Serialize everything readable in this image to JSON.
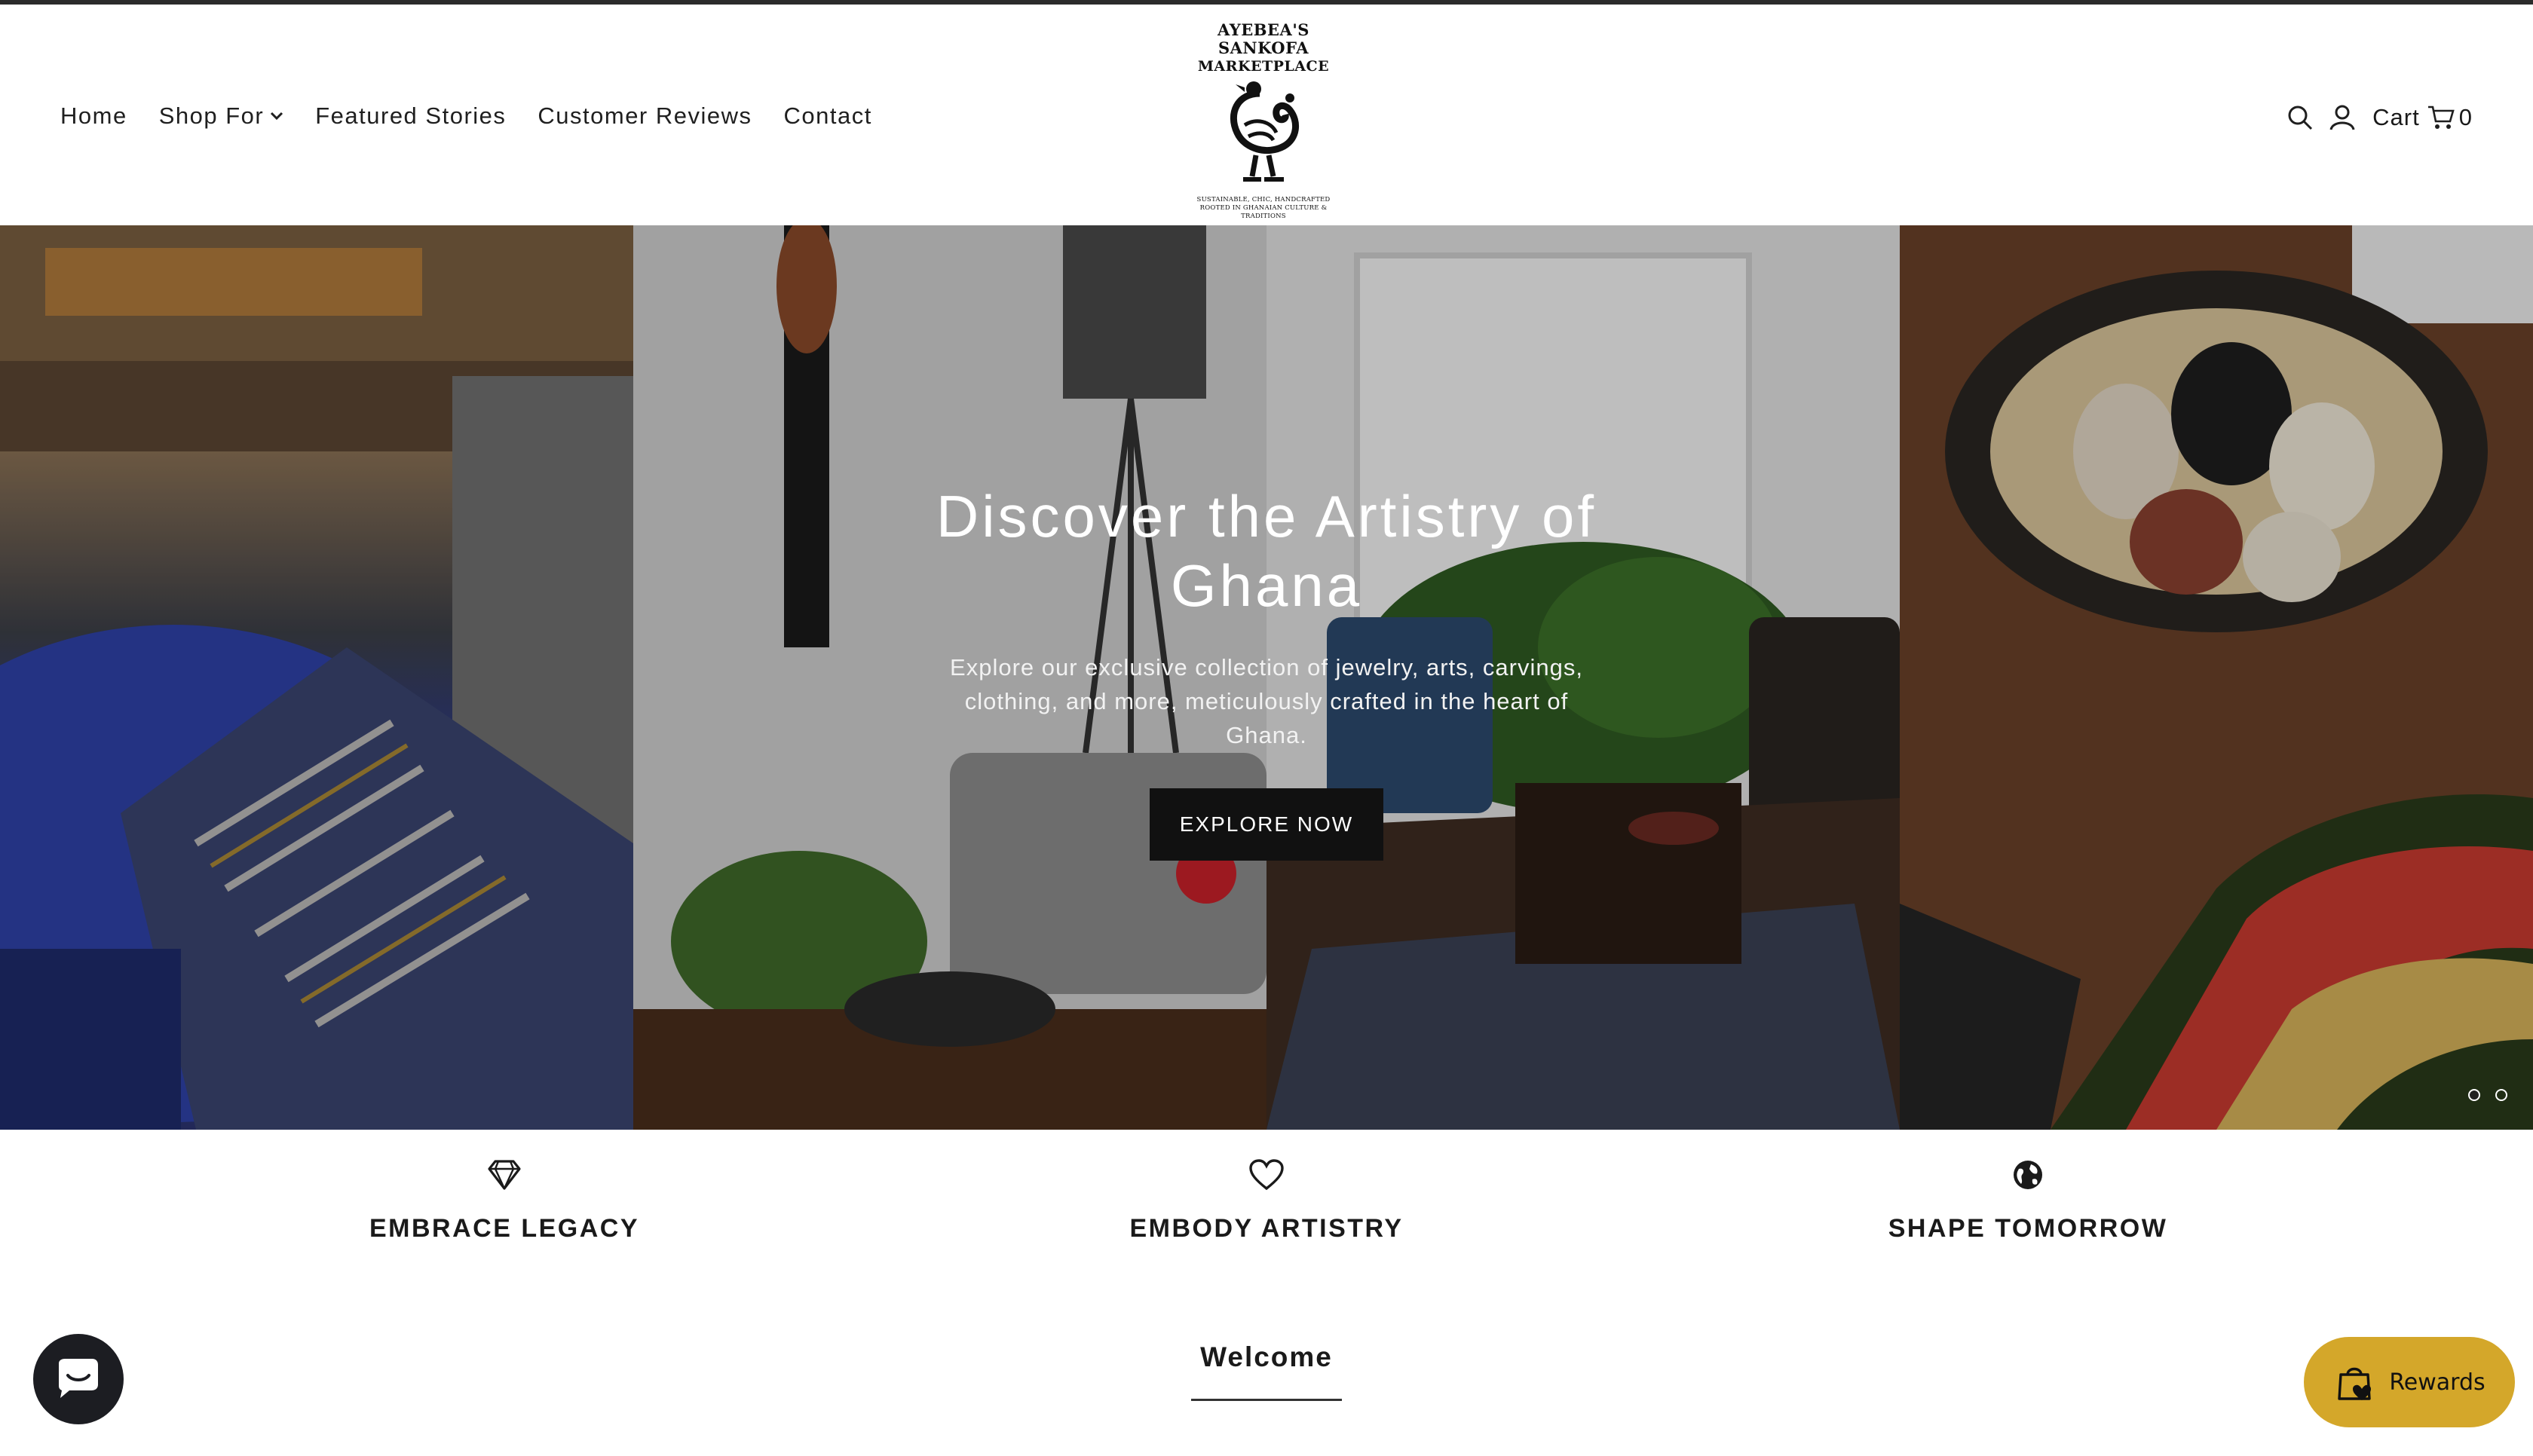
{
  "brand": {
    "name_line1": "AYEBEA'S SANKOFA",
    "name_line2": "MARKETPLACE",
    "tagline_line1": "SUSTAINABLE, CHIC, HANDCRAFTED",
    "tagline_line2": "ROOTED IN GHANAIAN CULTURE & TRADITIONS"
  },
  "nav": {
    "items": [
      {
        "label": "Home"
      },
      {
        "label": "Shop For",
        "has_dropdown": true
      },
      {
        "label": "Featured Stories"
      },
      {
        "label": "Customer Reviews"
      },
      {
        "label": "Contact"
      }
    ]
  },
  "header_right": {
    "search_icon": "search-icon",
    "account_icon": "user-icon",
    "cart_label": "Cart",
    "cart_icon": "cart-icon",
    "cart_count": "0"
  },
  "hero": {
    "title": "Discover the Artistry of Ghana",
    "subtitle": "Explore our exclusive collection of jewelry, arts, carvings, clothing, and more, meticulously crafted in the heart of Ghana.",
    "button_label": "EXPLORE NOW",
    "slide_count": 2,
    "active_slide": 1
  },
  "features": [
    {
      "icon": "diamond-icon",
      "title": "EMBRACE LEGACY"
    },
    {
      "icon": "heart-icon",
      "title": "EMBODY ARTISTRY"
    },
    {
      "icon": "globe-icon",
      "title": "SHAPE TOMORROW"
    }
  ],
  "welcome": {
    "title": "Welcome"
  },
  "floating": {
    "chat_icon": "chat-icon",
    "rewards_label": "Rewards",
    "rewards_color": "#d4a72a"
  }
}
